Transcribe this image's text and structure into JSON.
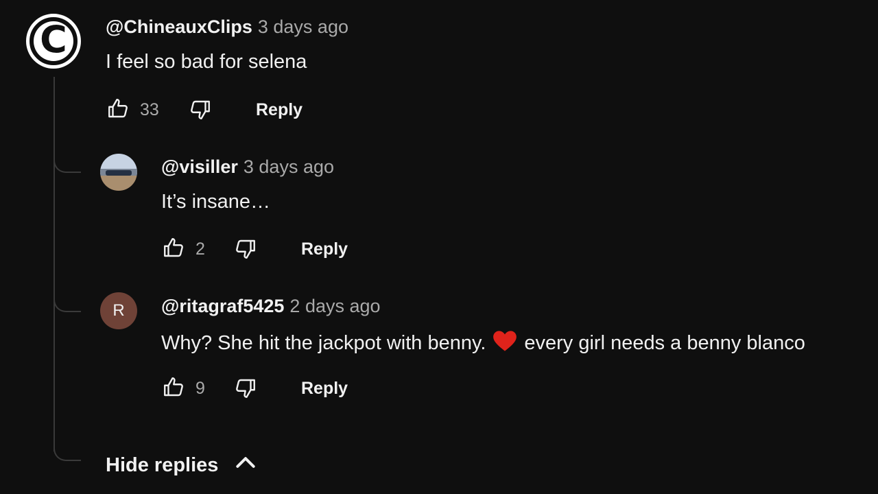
{
  "comments": [
    {
      "author": "@ChineauxClips",
      "time": "3 days ago",
      "text": "I feel so bad for selena",
      "likes": "33",
      "reply_label": "Reply",
      "avatar": "copyright-icon"
    },
    {
      "author": "@visiller",
      "time": "3 days ago",
      "text": "It’s insane…",
      "likes": "2",
      "reply_label": "Reply",
      "avatar": "photo-avatar"
    },
    {
      "author": "@ritagraf5425",
      "time": "2 days ago",
      "text_before": "Why? She hit the jackpot with benny.",
      "text_after": "every girl needs a benny blanco",
      "likes": "9",
      "reply_label": "Reply",
      "avatar_letter": "R"
    }
  ],
  "hide_replies_label": "Hide replies",
  "colors": {
    "background": "#0f0f0f",
    "text": "#f1f1f1",
    "secondary": "#aaaaaa",
    "thread_line": "#3a3a3a",
    "heart": "#e0231b",
    "rita_avatar": "#6f4237"
  },
  "icons": [
    "thumbs-up-icon",
    "thumbs-down-icon",
    "heart-emoji",
    "chevron-up-icon",
    "copyright-icon"
  ]
}
